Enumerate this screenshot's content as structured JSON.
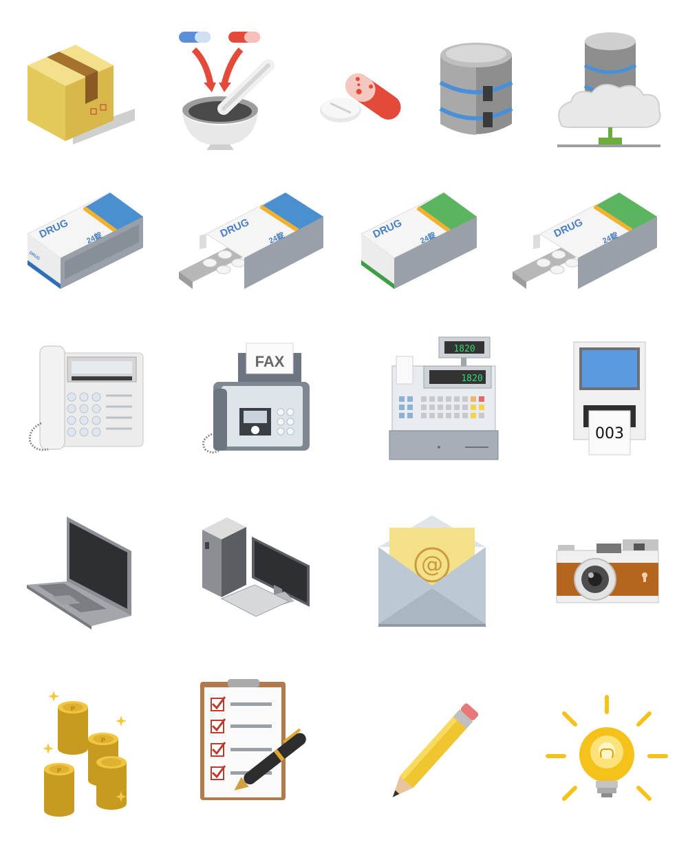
{
  "icons": [
    {
      "row": 0,
      "col": 0,
      "name": "cardboard-box-icon"
    },
    {
      "row": 0,
      "col": 1,
      "name": "mortar-pestle-capsules-icon"
    },
    {
      "row": 0,
      "col": 2,
      "name": "pill-capsule-icon"
    },
    {
      "row": 0,
      "col": 3,
      "name": "database-icon"
    },
    {
      "row": 0,
      "col": 4,
      "name": "cloud-database-icon"
    },
    {
      "row": 1,
      "col": 0,
      "name": "drug-box-blue-icon"
    },
    {
      "row": 1,
      "col": 1,
      "name": "drug-box-blue-open-icon"
    },
    {
      "row": 1,
      "col": 2,
      "name": "drug-box-green-icon"
    },
    {
      "row": 1,
      "col": 3,
      "name": "drug-box-green-open-icon"
    },
    {
      "row": 2,
      "col": 0,
      "name": "telephone-icon"
    },
    {
      "row": 2,
      "col": 1,
      "name": "fax-machine-icon"
    },
    {
      "row": 2,
      "col": 2,
      "name": "cash-register-icon"
    },
    {
      "row": 2,
      "col": 3,
      "name": "ticket-machine-icon"
    },
    {
      "row": 3,
      "col": 0,
      "name": "laptop-icon"
    },
    {
      "row": 3,
      "col": 1,
      "name": "desktop-computer-icon"
    },
    {
      "row": 3,
      "col": 2,
      "name": "email-envelope-icon"
    },
    {
      "row": 3,
      "col": 3,
      "name": "camera-icon"
    },
    {
      "row": 4,
      "col": 0,
      "name": "coins-icon"
    },
    {
      "row": 4,
      "col": 1,
      "name": "clipboard-checklist-icon"
    },
    {
      "row": 4,
      "col": 2,
      "name": "pencil-icon"
    },
    {
      "row": 4,
      "col": 3,
      "name": "light-bulb-icon"
    }
  ],
  "labels": {
    "drug": "DRUG",
    "count": "24錠",
    "drug_small": "DRUG",
    "fax": "FAX",
    "register_display": "1820",
    "ticket_number": "003",
    "email_symbol": "@",
    "coin_mark": "P"
  },
  "colors": {
    "blue_band": "#4a8fd0",
    "green_band": "#5bb55f",
    "gold_stripe": "#f2b230",
    "box_yellow": "#e9d36a",
    "red_capsule": "#e34a3a"
  }
}
